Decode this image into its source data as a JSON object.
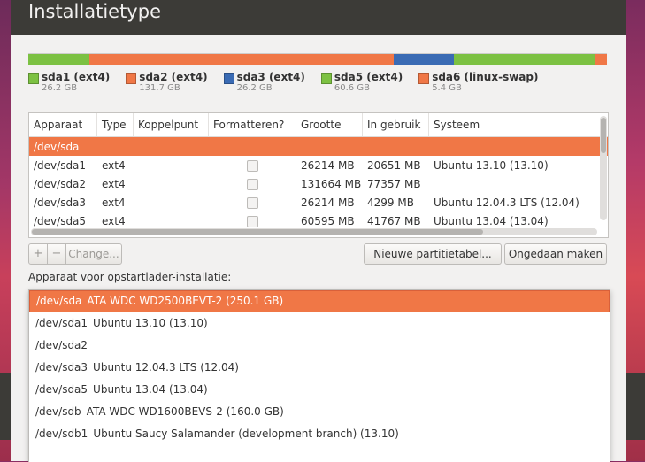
{
  "window": {
    "title": "Installatietype"
  },
  "partition_bar": {
    "segments": [
      {
        "name": "sda1",
        "fraction": 0.105,
        "color": "#7cc142"
      },
      {
        "name": "sda2",
        "fraction": 0.526,
        "color": "#f07746"
      },
      {
        "name": "sda3",
        "fraction": 0.105,
        "color": "#3a6bb4"
      },
      {
        "name": "sda5",
        "fraction": 0.242,
        "color": "#7cc142"
      },
      {
        "name": "sda6",
        "fraction": 0.022,
        "color": "#f07746"
      }
    ]
  },
  "legend": [
    {
      "name": "sda1 (ext4)",
      "size": "26.2 GB",
      "color": "#7cc142"
    },
    {
      "name": "sda2 (ext4)",
      "size": "131.7 GB",
      "color": "#f07746"
    },
    {
      "name": "sda3 (ext4)",
      "size": "26.2 GB",
      "color": "#3a6bb4"
    },
    {
      "name": "sda5 (ext4)",
      "size": "60.6 GB",
      "color": "#7cc142"
    },
    {
      "name": "sda6 (linux-swap)",
      "size": "5.4 GB",
      "color": "#f07746"
    }
  ],
  "table": {
    "columns": [
      "Apparaat",
      "Type",
      "Koppelpunt",
      "Formatteren?",
      "Grootte",
      "In gebruik",
      "Systeem"
    ],
    "header_row": "/dev/sda",
    "rows": [
      {
        "device": "/dev/sda1",
        "type": "ext4",
        "mount": "",
        "size": "26214 MB",
        "used": "20651 MB",
        "system": "Ubuntu 13.10 (13.10)"
      },
      {
        "device": "/dev/sda2",
        "type": "ext4",
        "mount": "",
        "size": "131664 MB",
        "used": "77357 MB",
        "system": ""
      },
      {
        "device": "/dev/sda3",
        "type": "ext4",
        "mount": "",
        "size": "26214 MB",
        "used": "4299 MB",
        "system": "Ubuntu 12.04.3 LTS (12.04)"
      },
      {
        "device": "/dev/sda5",
        "type": "ext4",
        "mount": "",
        "size": "60595 MB",
        "used": "41767 MB",
        "system": "Ubuntu 13.04 (13.04)"
      }
    ]
  },
  "buttons": {
    "add": "+",
    "remove": "−",
    "change": "Change...",
    "new_table": "Nieuwe partitietabel...",
    "undo": "Ongedaan maken"
  },
  "bootloader": {
    "label": "Apparaat voor opstartlader-installatie:",
    "options": [
      {
        "device": "/dev/sda",
        "desc": "ATA WDC WD2500BEVT-2 (250.1 GB)",
        "selected": true
      },
      {
        "device": "/dev/sda1",
        "desc": "Ubuntu 13.10 (13.10)"
      },
      {
        "device": "/dev/sda2",
        "desc": ""
      },
      {
        "device": "/dev/sda3",
        "desc": "Ubuntu 12.04.3 LTS (12.04)"
      },
      {
        "device": "/dev/sda5",
        "desc": "Ubuntu 13.04 (13.04)"
      },
      {
        "device": "/dev/sdb",
        "desc": "ATA WDC WD1600BEVS-2 (160.0 GB)"
      },
      {
        "device": "/dev/sdb1",
        "desc": "Ubuntu Saucy Salamander (development branch) (13.10)"
      }
    ]
  }
}
